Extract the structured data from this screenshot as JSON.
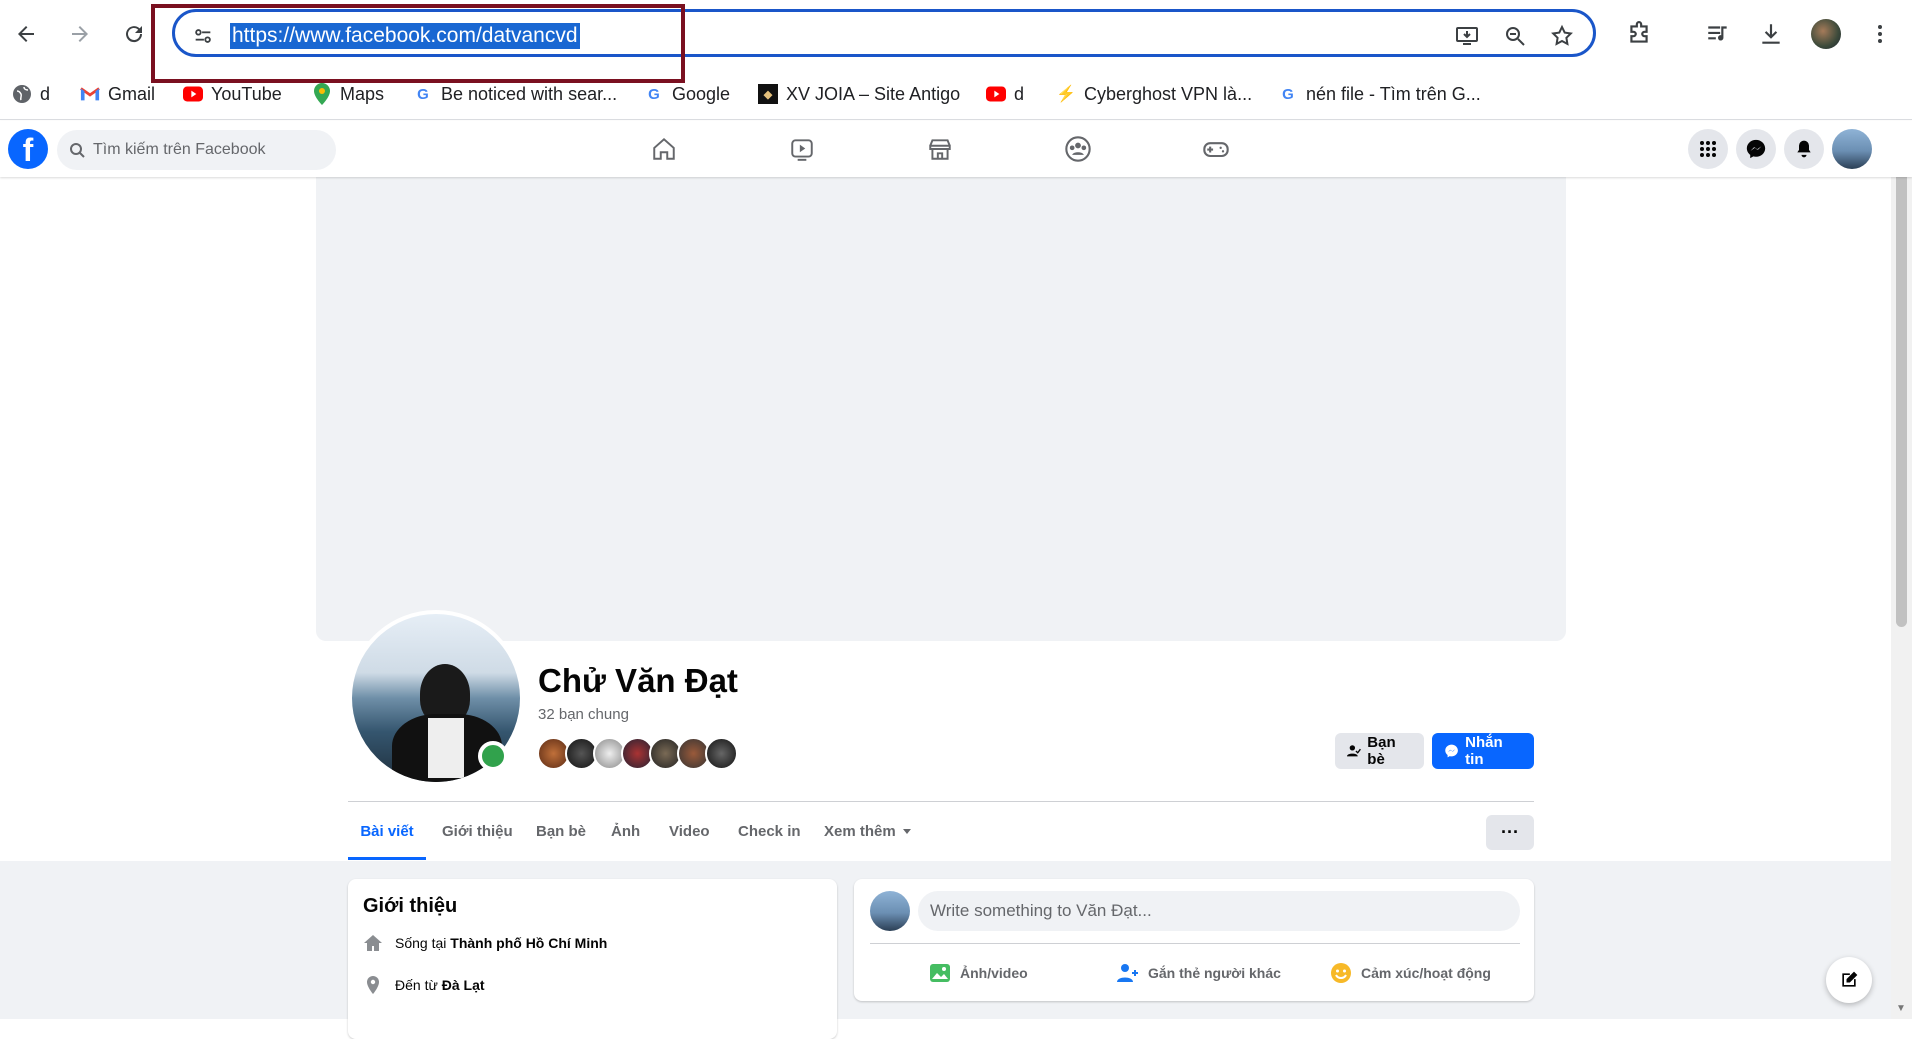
{
  "browser": {
    "url": "https://www.facebook.com/datvancvd",
    "bookmarks": [
      {
        "label": "d",
        "icon": "globe-icon"
      },
      {
        "label": "Gmail",
        "icon": "gmail-icon"
      },
      {
        "label": "YouTube",
        "icon": "youtube-icon"
      },
      {
        "label": "Maps",
        "icon": "maps-icon"
      },
      {
        "label": "Be noticed with sear...",
        "icon": "google-icon"
      },
      {
        "label": "Google",
        "icon": "google-icon"
      },
      {
        "label": "XV JOIA – Site Antigo",
        "icon": "site-icon"
      },
      {
        "label": "d",
        "icon": "youtube-icon"
      },
      {
        "label": "Cyberghost VPN là...",
        "icon": "cyberghost-icon"
      },
      {
        "label": "nén file - Tìm trên G...",
        "icon": "google-icon"
      }
    ]
  },
  "facebook": {
    "search_placeholder": "Tìm kiếm trên Facebook",
    "profile": {
      "name": "Chử Văn Đạt",
      "mutual_friends": "32 bạn chung",
      "friends_button": "Bạn bè",
      "message_button": "Nhắn tin"
    },
    "tabs": [
      "Bài viết",
      "Giới thiệu",
      "Bạn bè",
      "Ảnh",
      "Video",
      "Check in",
      "Xem thêm"
    ],
    "intro": {
      "title": "Giới thiệu",
      "lives_prefix": "Sống tại",
      "lives_city": "Thành phố Hồ Chí Minh",
      "from_prefix": "Đến từ",
      "from_city": "Đà Lạt"
    },
    "composer": {
      "placeholder": "Write something to Văn Đạt...",
      "actions": [
        "Ảnh/video",
        "Gắn thẻ người khác",
        "Cảm xúc/hoạt động"
      ]
    }
  },
  "colors": {
    "fb_blue": "#0866ff",
    "online_green": "#31a24c",
    "highlight_border": "#7a1020",
    "omnibox_border": "#1a56c9"
  }
}
